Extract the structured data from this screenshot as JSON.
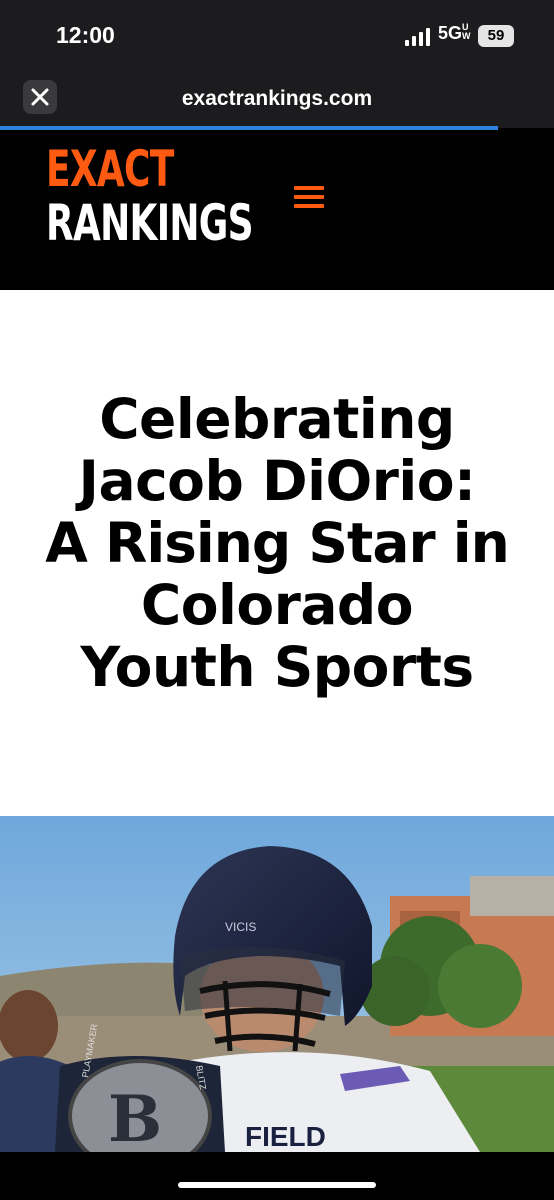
{
  "status_bar": {
    "time": "12:00",
    "network": "5G",
    "network_suffix": "UW",
    "battery": "59"
  },
  "browser": {
    "url": "exactrankings.com",
    "close_icon": "close-icon",
    "accent": "#2f82e0"
  },
  "site": {
    "logo_line1": "EXACT",
    "logo_line2": "RANKINGS",
    "menu_icon": "hamburger-menu-icon",
    "brand_color": "#ff5a12"
  },
  "article": {
    "title_lines": [
      "Celebrating",
      "Jacob DiOrio:",
      "A Rising Star in",
      "Colorado",
      "Youth Sports"
    ]
  },
  "hero_image": {
    "belt_letter": "B",
    "belt_text": "PLAYMAKER",
    "belt_text2": "BLITZ",
    "jersey_text": "FIELD",
    "helmet_text": "VICIS"
  }
}
